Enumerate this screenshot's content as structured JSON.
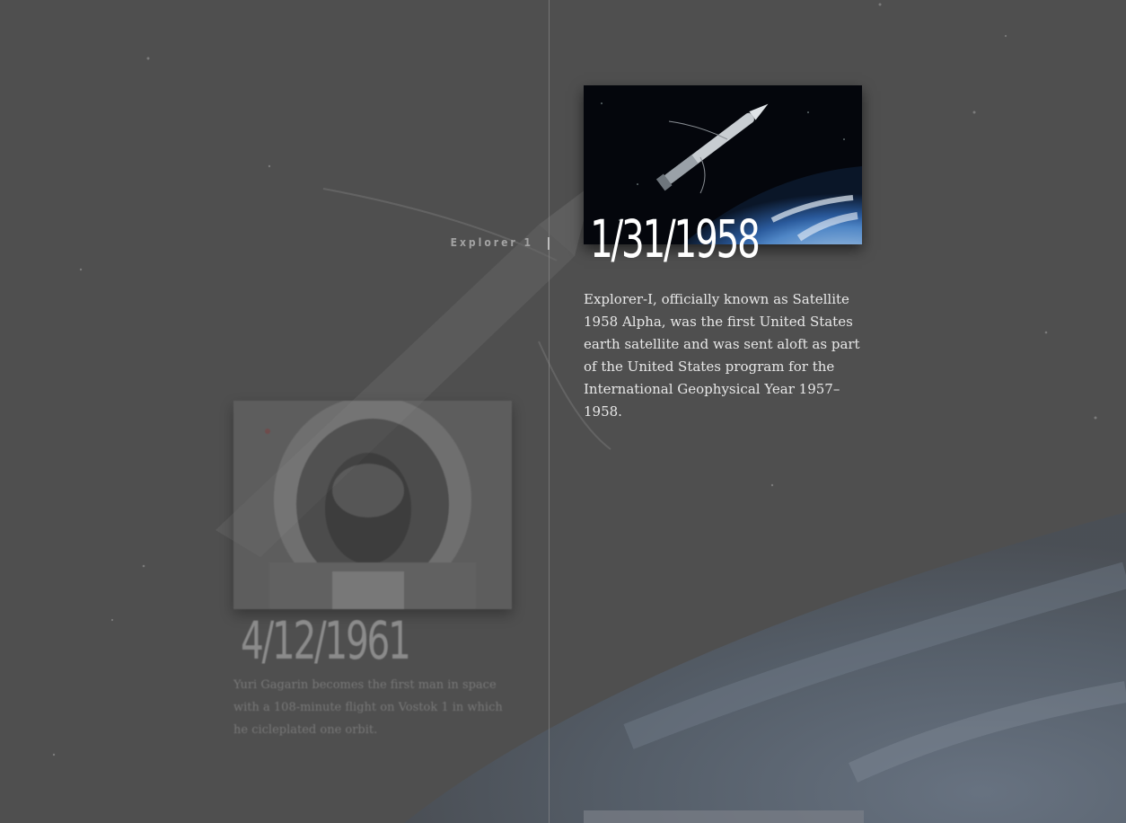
{
  "nav": {
    "label": "Explorer 1"
  },
  "events": [
    {
      "date": "1/31/1958",
      "description": "Explorer-I, officially known as Satellite 1958 Alpha, was the first United States earth satellite and was sent aloft as part of the United States program for the International Geophysical Year 1957–1958.",
      "image": "explorer-1-satellite-over-earth"
    },
    {
      "date": "4/12/1961",
      "description": "Yuri Gagarin becomes the first man in space with a 108-minute flight on Vostok 1 in which he cicleplated one orbit.",
      "image": "yuri-gagarin-in-helmet"
    }
  ],
  "colors": {
    "background": "#505050",
    "timeline": "#969696",
    "text_primary": "#ffffff"
  }
}
